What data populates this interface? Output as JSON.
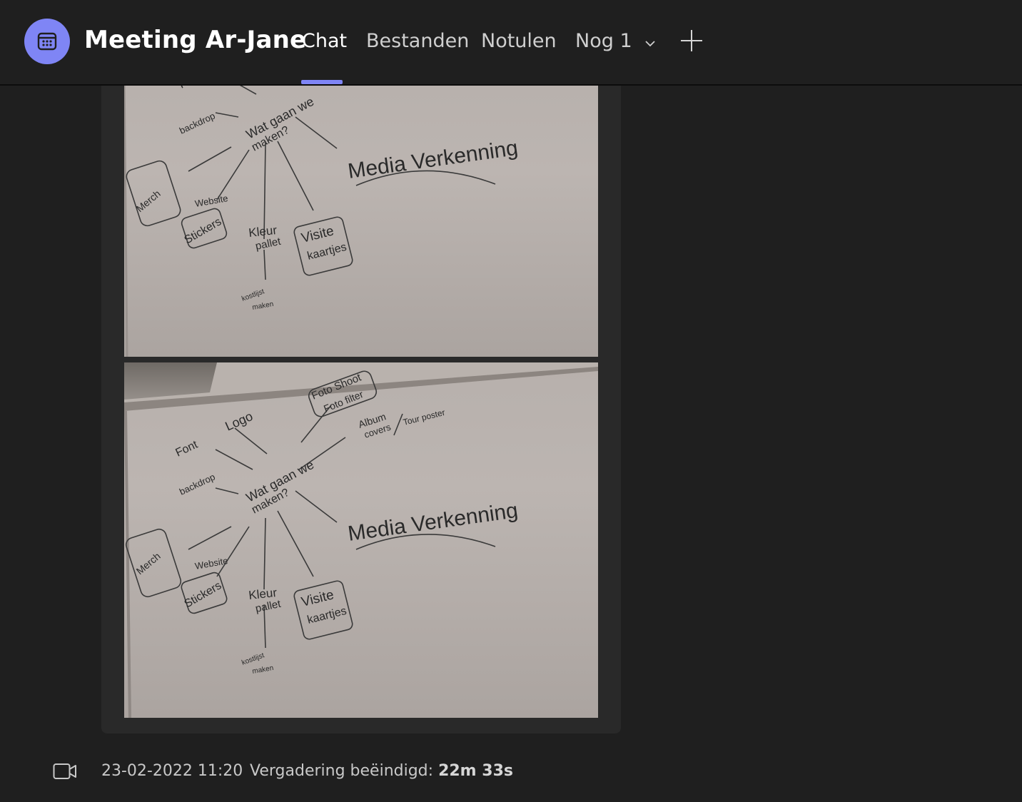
{
  "header": {
    "title": "Meeting Ar-Jane",
    "app_icon": "calendar-icon",
    "accent_color": "#7f85f5",
    "tabs": [
      {
        "label": "Chat",
        "active": true
      },
      {
        "label": "Bestanden",
        "active": false
      },
      {
        "label": "Notulen",
        "active": false
      },
      {
        "label": "Nog 1",
        "active": false
      }
    ],
    "add_tab_icon": "plus-icon"
  },
  "message": {
    "images": [
      {
        "alt": "whiteboard-photo-1",
        "notes": {
          "center": "Wat gaan we",
          "center2": "maken?",
          "title": "Media Verkenning",
          "font": "Font",
          "backdrop": "backdrop",
          "merch": "Merch",
          "website": "Website",
          "stickers": "Stickers",
          "kleur": "Kleur",
          "pallet": "pallet",
          "visite": "Visite",
          "kaartjes": "kaartjes",
          "kost1": "kostlijst",
          "kost2": "maken"
        }
      },
      {
        "alt": "whiteboard-photo-2",
        "notes": {
          "fotoshoot": "Foto Shoot",
          "fotofilter": "Foto filter",
          "logo": "Logo",
          "album": "Album",
          "covers": "covers",
          "tourposter": "Tour poster",
          "center": "Wat gaan we",
          "center2": "maken?",
          "title": "Media Verkenning",
          "font": "Font",
          "backdrop": "backdrop",
          "merch": "Merch",
          "website": "Website",
          "stickers": "Stickers",
          "kleur": "Kleur",
          "pallet": "pallet",
          "visite": "Visite",
          "kaartjes": "kaartjes",
          "kost1": "kostlijst",
          "kost2": "maken"
        }
      }
    ]
  },
  "footer": {
    "icon": "video-camera-icon",
    "timestamp": "23-02-2022 11:20",
    "status_label": "Vergadering beëindigd:",
    "duration": "22m 33s"
  }
}
